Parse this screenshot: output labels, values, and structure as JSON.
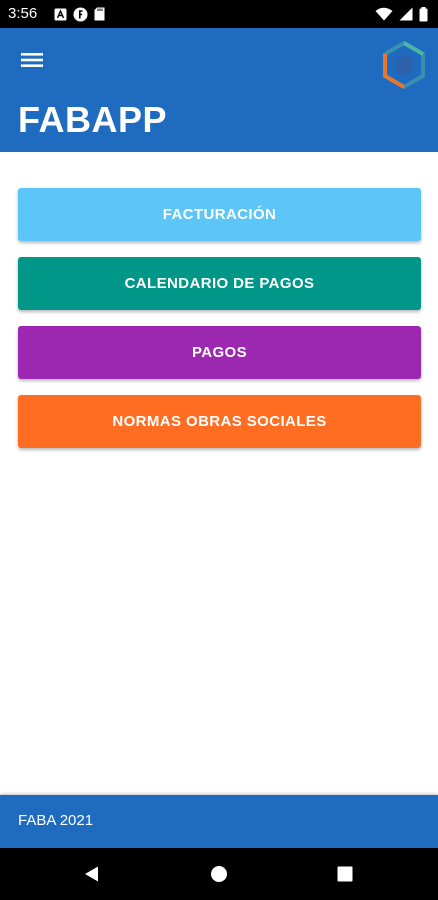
{
  "status_bar": {
    "time": "3:56",
    "left_icons": [
      "notification-a-icon",
      "notification-f-icon",
      "sd-card-icon"
    ],
    "right_icons": [
      "wifi-icon",
      "signal-icon",
      "battery-icon"
    ]
  },
  "app_bar": {
    "title": "FABAPP",
    "menu_icon": "hamburger-menu-icon",
    "logo_icon": "hexagon-logo-icon",
    "background": "#1e6bc0"
  },
  "menu": {
    "items": [
      {
        "label": "FACTURACIÓN",
        "color": "#5bc6f7"
      },
      {
        "label": "CALENDARIO DE PAGOS",
        "color": "#009688"
      },
      {
        "label": "PAGOS",
        "color": "#9c27b0"
      },
      {
        "label": "NORMAS OBRAS SOCIALES",
        "color": "#ff6d22"
      }
    ]
  },
  "footer": {
    "text": "FABA 2021"
  },
  "nav_bar": {
    "icons": [
      "back-icon",
      "home-icon",
      "recents-icon"
    ]
  }
}
